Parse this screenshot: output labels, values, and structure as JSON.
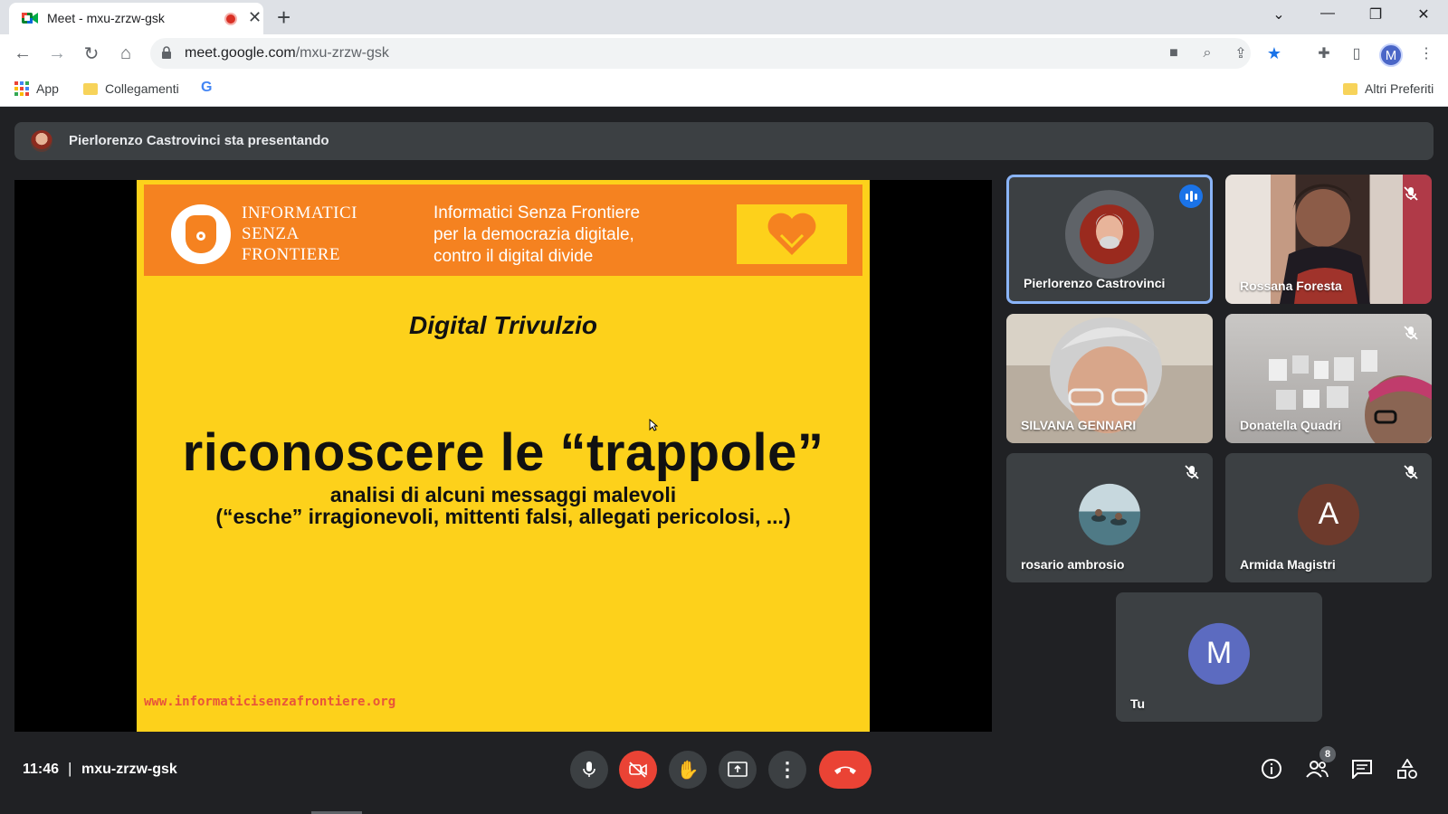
{
  "browser": {
    "tab_title": "Meet - mxu-zrzw-gsk",
    "url_host": "meet.google.com",
    "url_path": "/mxu-zrzw-gsk",
    "profile_initial": "M",
    "bookmarks": {
      "apps": "App",
      "folder1": "Collegamenti",
      "google": "G",
      "other": "Altri Preferiti"
    }
  },
  "meet": {
    "presenting_text": "Pierlorenzo Castrovinci sta presentando",
    "time": "11:46",
    "separator": "|",
    "code": "mxu-zrzw-gsk",
    "participants_count": "8"
  },
  "slide": {
    "org_name_line1": "INFORMATICI",
    "org_name_line2": "SENZA",
    "org_name_line3": "FRONTIERE",
    "tagline_line1": "Informatici Senza Frontiere",
    "tagline_line2": "per la democrazia digitale,",
    "tagline_line3": "contro il digital divide",
    "subtitle": "Digital Trivulzio",
    "title": "riconoscere le “trappole”",
    "line1": "analisi di alcuni messaggi malevoli",
    "line2": "(“esche” irragionevoli, mittenti falsi, allegati pericolosi, ...)",
    "footer_url": "www.informaticisenzafrontiere.org"
  },
  "participants": [
    {
      "name": "Pierlorenzo Castrovinci",
      "state": "speaking"
    },
    {
      "name": "Rossana Foresta",
      "state": "muted"
    },
    {
      "name": "SILVANA GENNARI",
      "state": "unmuted"
    },
    {
      "name": "Donatella Quadri",
      "state": "muted"
    },
    {
      "name": "rosario ambrosio",
      "state": "muted"
    },
    {
      "name": "Armida Magistri",
      "state": "muted",
      "initial": "A"
    },
    {
      "name": "Tu",
      "state": "self",
      "initial": "M"
    }
  ],
  "colors": {
    "meet_bg": "#202124",
    "tile_bg": "#3c4043",
    "hangup": "#ea4335",
    "slide_yellow": "#fdd11b",
    "slide_orange": "#f58220",
    "self_avatar": "#5c6bc0",
    "armida_avatar": "#6d3a2c"
  }
}
